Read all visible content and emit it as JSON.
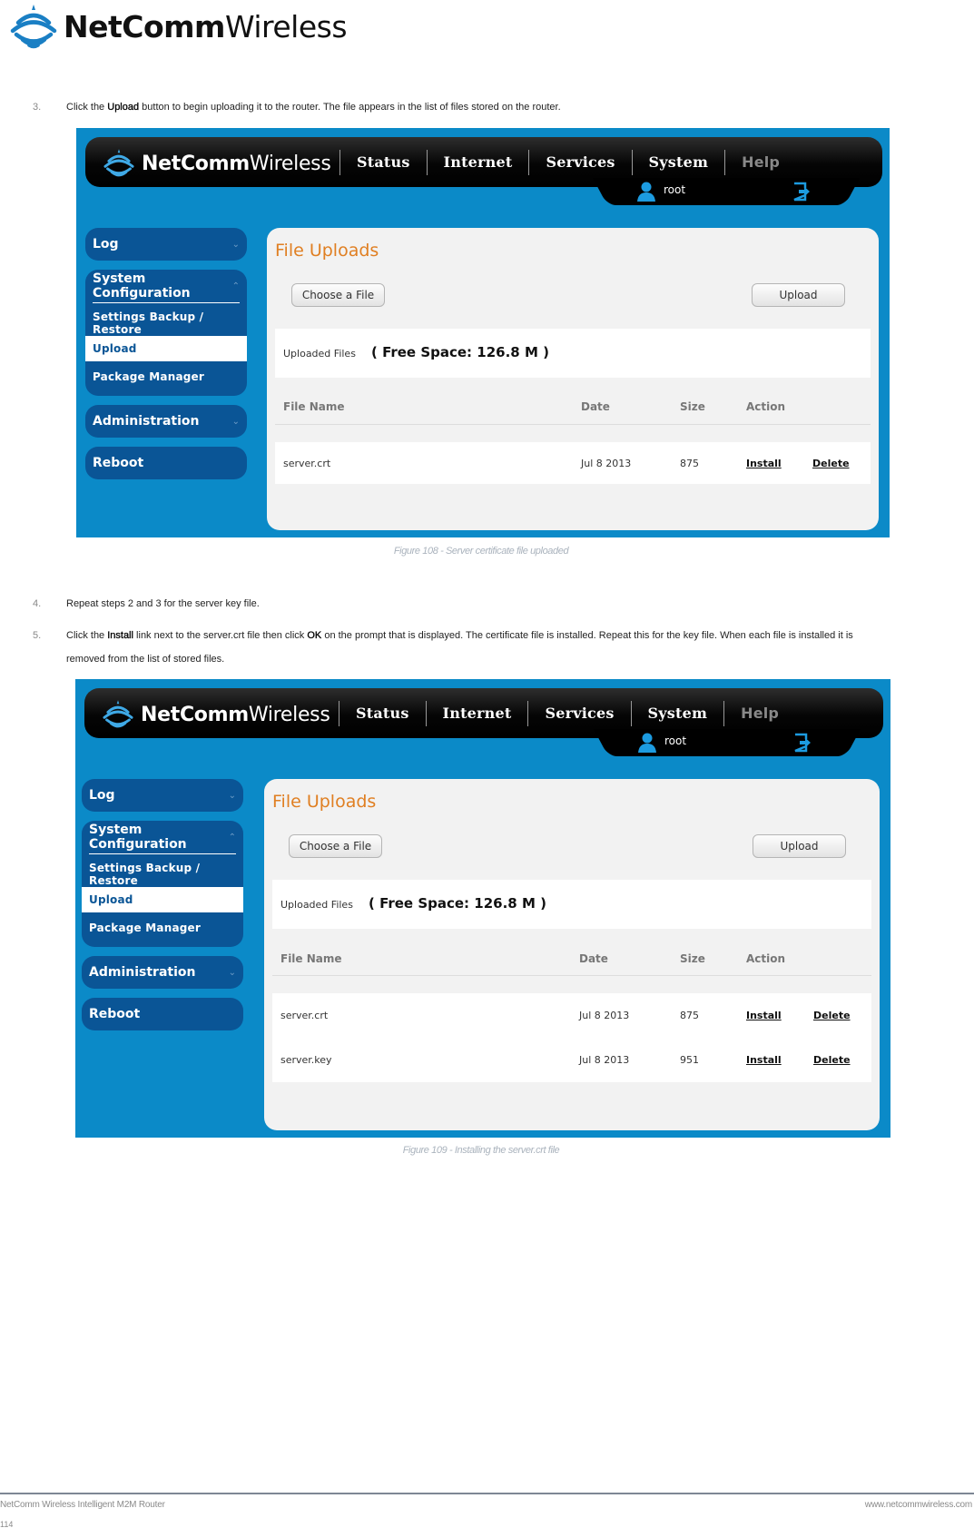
{
  "page_header": {
    "brand_bold": "NetComm",
    "brand_light": "Wireless"
  },
  "steps": [
    {
      "num": "3.",
      "parts": [
        "Click the ",
        "Upload",
        " button to begin uploading it to the router. The file appears in the list of files stored on the router."
      ]
    },
    {
      "num": "4.",
      "parts": [
        "Repeat steps 2 and 3 for the server key file."
      ]
    },
    {
      "num": "5.",
      "parts": [
        "Click the ",
        "Install",
        " link next to the server.crt file then click ",
        "OK",
        " on the prompt that is displayed. The certificate file is installed. Repeat this for the key file. When each file is installed it is",
        "removed from the list of stored files."
      ]
    }
  ],
  "figures": [
    {
      "caption": "Figure 108 - Server certificate file uploaded",
      "files": [
        {
          "name": "server.crt",
          "date": "Jul 8 2013",
          "size": "875",
          "install": "Install",
          "delete": "Delete"
        }
      ]
    },
    {
      "caption": "Figure 109 - Installing the server.crt file",
      "files": [
        {
          "name": "server.crt",
          "date": "Jul 8 2013",
          "size": "875",
          "install": "Install",
          "delete": "Delete"
        },
        {
          "name": "server.key",
          "date": "Jul 8 2013",
          "size": "951",
          "install": "Install",
          "delete": "Delete"
        }
      ]
    }
  ],
  "router_ui": {
    "brand_bold": "NetComm",
    "brand_light": "Wireless",
    "nav": [
      "Status",
      "Internet",
      "Services",
      "System",
      "Help"
    ],
    "user": "root",
    "sidebar": {
      "log": "Log",
      "system_configuration": "System Configuration",
      "sub_items": [
        "Settings Backup / Restore",
        "Upload",
        "Package Manager"
      ],
      "active_sub_item": "Upload",
      "administration": "Administration",
      "reboot": "Reboot"
    },
    "page_title": "File Uploads",
    "choose_file_button": "Choose a File",
    "upload_button": "Upload",
    "uploaded_files_label": "Uploaded Files",
    "free_space": "( Free Space: 126.8 M )",
    "columns": [
      "File Name",
      "Date",
      "Size",
      "Action"
    ]
  },
  "colors": {
    "accent_blue": "#0b8ac8",
    "sidebar_blue": "#0a5596",
    "title_orange": "#e07f22"
  },
  "footer": {
    "left": "NetComm Wireless Intelligent M2M Router",
    "right": "www.netcommwireless.com",
    "page_number": "114"
  }
}
